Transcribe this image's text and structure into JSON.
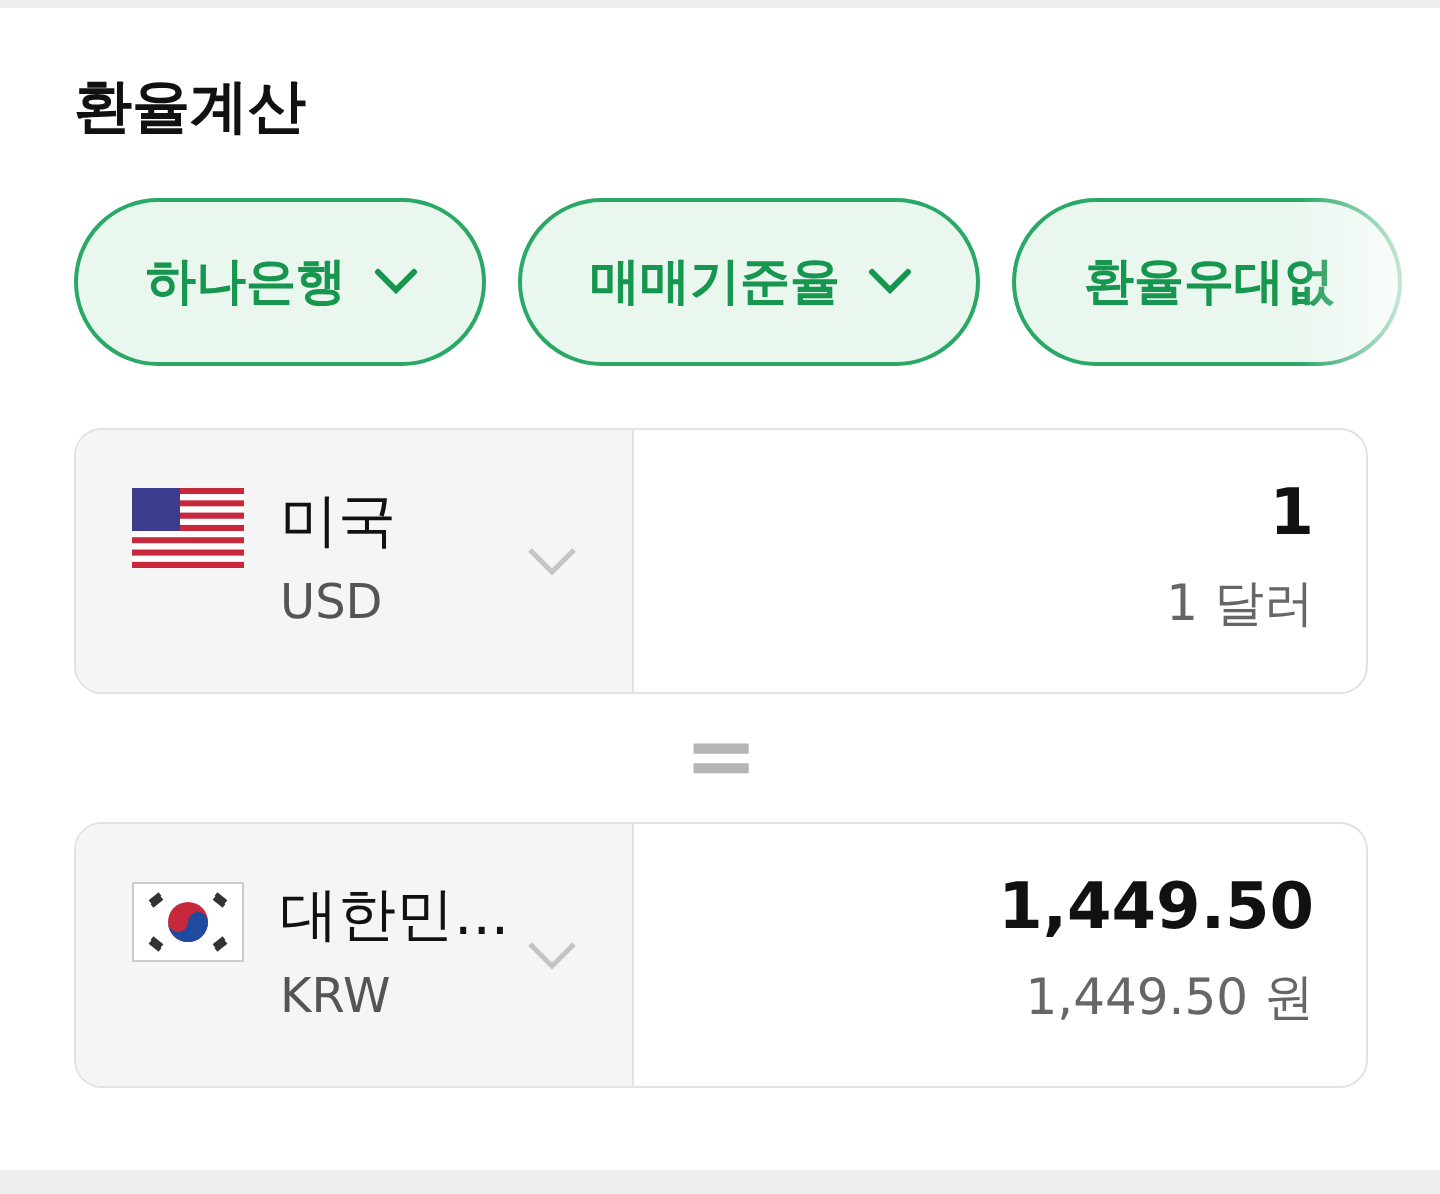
{
  "title": "환율계산",
  "filters": [
    {
      "label": "하나은행",
      "caret": true
    },
    {
      "label": "매매기준율",
      "caret": true
    },
    {
      "label": "환율우대없",
      "caret": false
    }
  ],
  "currencies": [
    {
      "kind": "us",
      "country": "미국",
      "code": "USD",
      "amount": "1",
      "amount_words": "1 달러"
    },
    {
      "kind": "kr",
      "country": "대한민...",
      "code": "KRW",
      "amount": "1,449.50",
      "amount_words": "1,449.50 원"
    }
  ],
  "separator": "="
}
